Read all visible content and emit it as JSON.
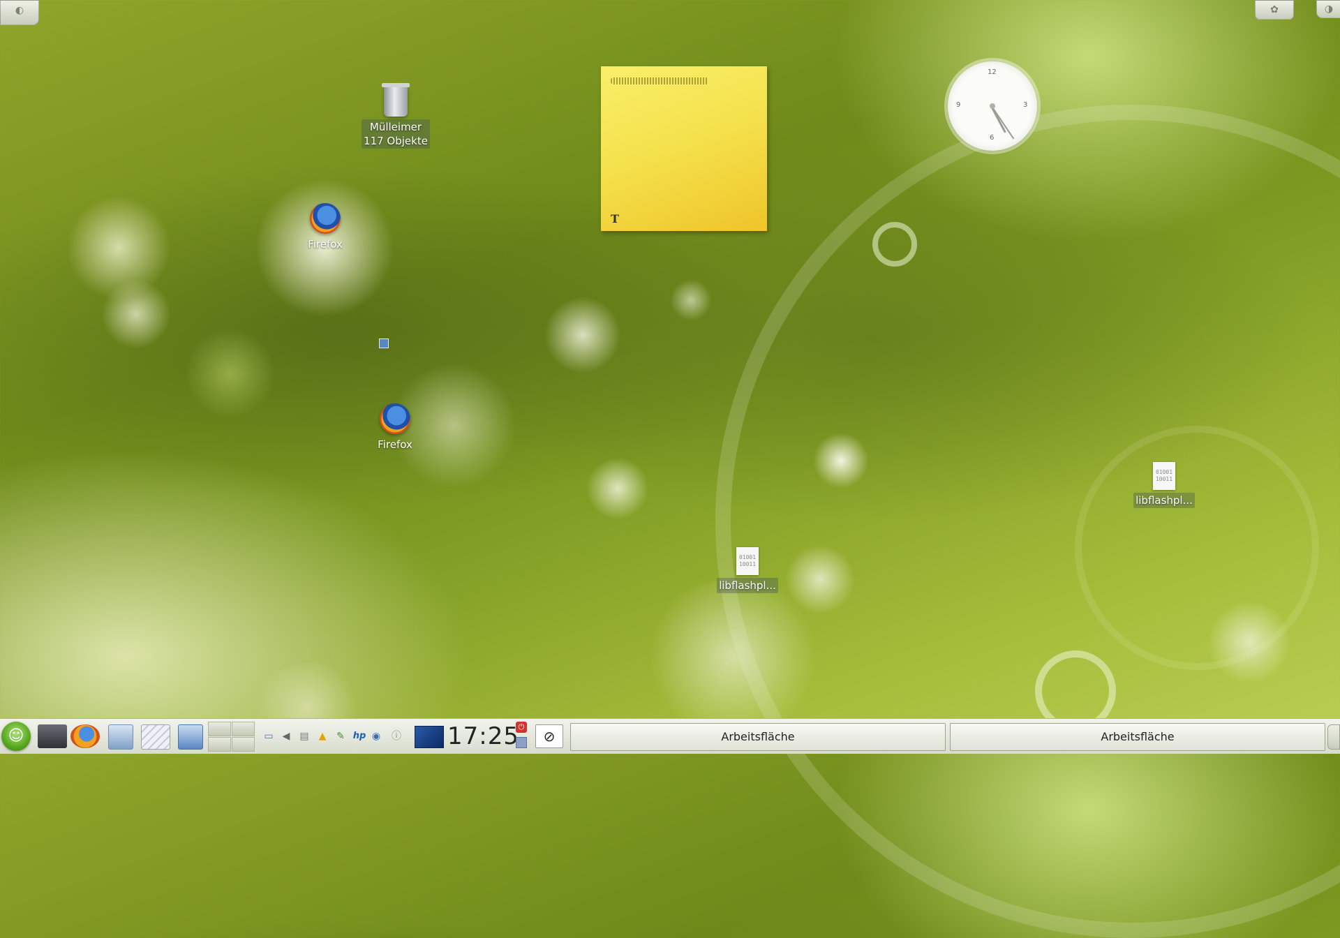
{
  "desktop": {
    "icons": [
      {
        "name": "trash",
        "line1": "Mülleimer",
        "line2": "117 Objekte"
      },
      {
        "name": "firefox-1",
        "label": "Firefox"
      },
      {
        "name": "firefox-2",
        "label": "Firefox"
      },
      {
        "name": "libflash-1",
        "label": "libflashpl...",
        "file_glyph": "01001\n10011"
      },
      {
        "name": "libflash-2",
        "label": "libflashpl...",
        "file_glyph": "01001\n10011"
      }
    ],
    "note": {
      "text_tool_glyph": "T"
    },
    "clock_widget": {
      "numerals": [
        "12",
        "3",
        "6",
        "9"
      ]
    }
  },
  "taskbar": {
    "kmenu_icon": "opensuse-gecko-icon",
    "launchers": [
      "network-icon",
      "firefox-icon",
      "file-manager-icon",
      "screenshot-icon",
      "desktop-window-icon"
    ],
    "tray": [
      "monitor-icon",
      "speaker-icon",
      "clipboard-icon",
      "warning-icon",
      "plug-icon",
      "hp-icon",
      "network-manager-icon",
      "info-icon"
    ],
    "time": "17:25",
    "tasks": [
      {
        "label": "Arbeitsfläche"
      },
      {
        "label": "Arbeitsfläche"
      }
    ]
  }
}
